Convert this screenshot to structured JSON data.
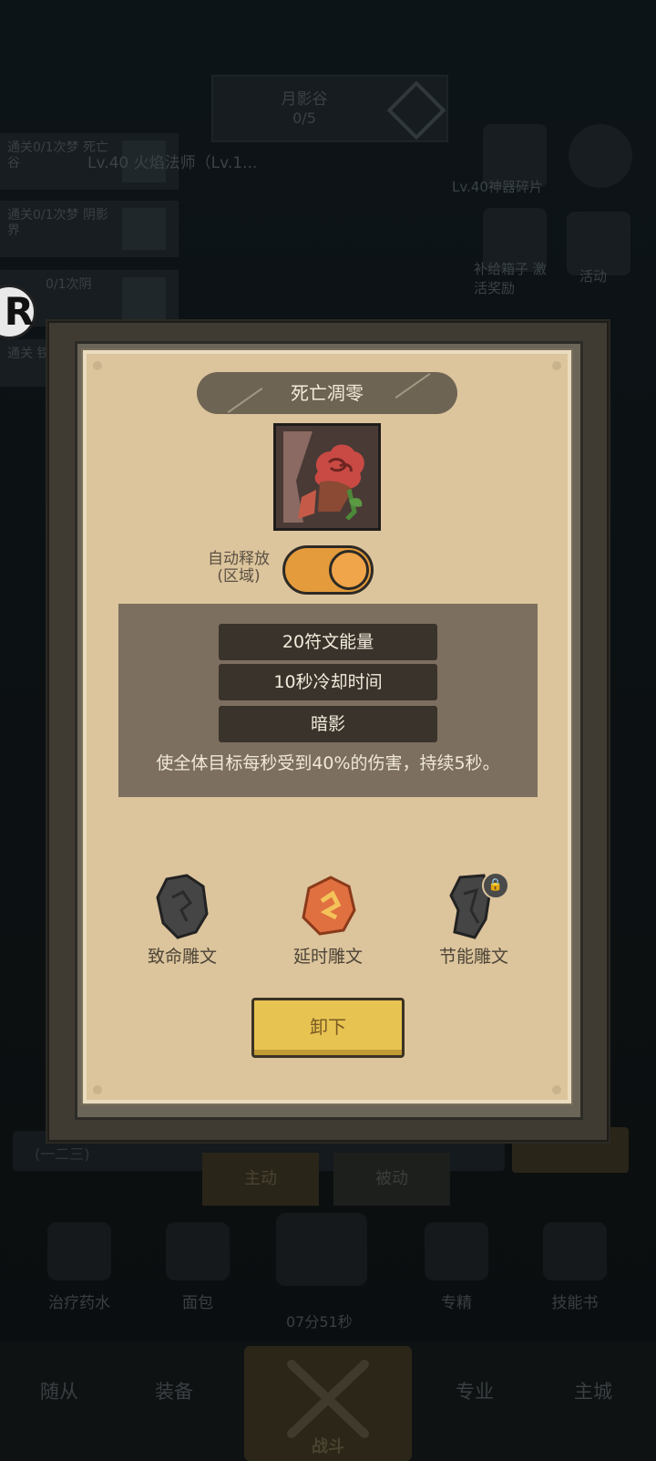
{
  "background": {
    "stage": {
      "name": "月影谷",
      "progress": "0/5"
    },
    "quests": [
      {
        "text": "通关0/1次梦 死亡谷"
      },
      {
        "text": "通关0/1次梦 阴影界"
      },
      {
        "text": "0/1次阴"
      },
      {
        "text": "通关 铁锈墓"
      }
    ],
    "top_strip": "Lv.40 火焰法师（Lv.1...",
    "right_labels": [
      "Lv.40神器碎片",
      "活动",
      "补给箱子 激活奖励"
    ],
    "tabs": {
      "active": "主动",
      "passive": "被动"
    },
    "bar_left_text": "(一二三)",
    "items": [
      "治疗药水",
      "面包",
      "专精",
      "技能书"
    ],
    "timer": "07分51秒",
    "nav": {
      "followers": "随从",
      "equipment": "装备",
      "battle": "战斗",
      "specialty": "专业",
      "city": "主城"
    }
  },
  "modal": {
    "title": "死亡凋零",
    "skill_icon": "withered-rose-icon",
    "auto_release_label_line1": "自动释放",
    "auto_release_label_line2": "(区域)",
    "auto_release_on": true,
    "stats": {
      "energy": "20符文能量",
      "cooldown": "10秒冷却时间",
      "element": "暗影"
    },
    "description": "使全体目标每秒受到40%的伤害，持续5秒。",
    "runes": [
      {
        "name": "致命雕文",
        "icon": "dark-stone-rune-icon",
        "locked": false
      },
      {
        "name": "延时雕文",
        "icon": "orange-rune-icon",
        "locked": false
      },
      {
        "name": "节能雕文",
        "icon": "dark-stone-rune-icon",
        "locked": true
      }
    ],
    "unequip_label": "卸下"
  },
  "colors": {
    "paper": "#dcc49c",
    "panel": "#7c6f5f",
    "pill": "#3a332b",
    "toggle_on": "#e49b3c",
    "button": "#e7c352"
  }
}
